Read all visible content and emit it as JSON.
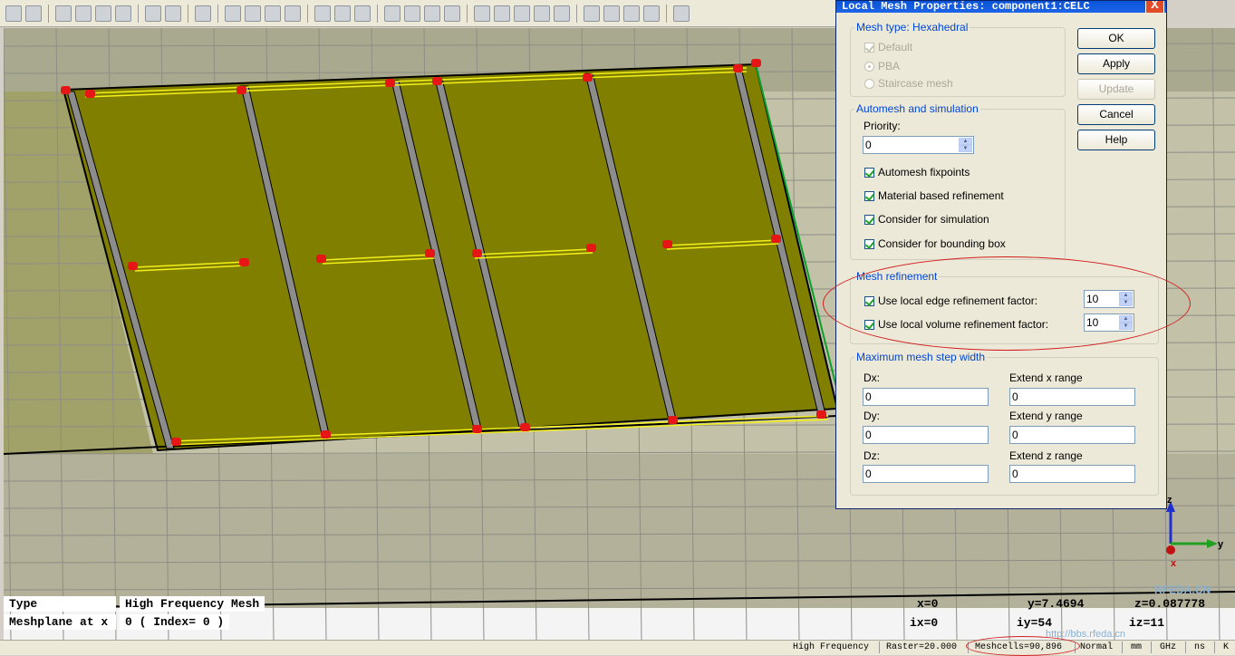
{
  "colors": {
    "board": "#807f00",
    "strip": "#8c8c8c",
    "port": "#e61616",
    "trace": "#f3f01a",
    "background": "#c3c1a8"
  },
  "dialog": {
    "title": "Local Mesh Properties: component1:CELC",
    "close_label": "X",
    "mesh_type": {
      "legend": "Mesh type: Hexahedral",
      "default_label": "Default",
      "pba_label": "PBA",
      "staircase_label": "Staircase mesh"
    },
    "automesh": {
      "legend": "Automesh and simulation",
      "priority_label": "Priority:",
      "priority_value": "0",
      "fixpoints_label": "Automesh fixpoints",
      "material_label": "Material based refinement",
      "simulation_label": "Consider for simulation",
      "bbox_label": "Consider for bounding box"
    },
    "refinement": {
      "legend": "Mesh refinement",
      "edge_label": "Use local edge refinement factor:",
      "edge_value": "10",
      "volume_label": "Use local volume refinement factor:",
      "volume_value": "10"
    },
    "step": {
      "legend": "Maximum mesh step width",
      "dx_label": "Dx:",
      "dx_value": "0",
      "dy_label": "Dy:",
      "dy_value": "0",
      "dz_label": "Dz:",
      "dz_value": "0",
      "ex_label": "Extend x range",
      "ex_value": "0",
      "ey_label": "Extend y range",
      "ey_value": "0",
      "ez_label": "Extend z range",
      "ez_value": "0"
    },
    "buttons": {
      "ok": "OK",
      "apply": "Apply",
      "update": "Update",
      "cancel": "Cancel",
      "help": "Help"
    }
  },
  "info": {
    "type_label": "Type",
    "type_value": "High Frequency Mesh",
    "meshplane_label": "Meshplane at x",
    "meshplane_value": "0 ( Index= 0 )",
    "x": "x=0",
    "y": "y=7.4694",
    "z": "z=0.087778",
    "ix": "ix=0",
    "iy": "iy=54",
    "iz": "iz=11"
  },
  "axes": {
    "z": "z",
    "y": "y",
    "x": "x"
  },
  "status": {
    "solver": "High Frequency",
    "raster": "Raster=20.000",
    "meshcells": "Meshcells=90,896",
    "mode": "Normal",
    "length_unit": "mm",
    "freq_unit": "GHz",
    "time_unit": "ns",
    "temp_unit": "K"
  },
  "watermark": {
    "site": "RFEDA.CN",
    "url": "http://bbs.rfeda.cn"
  }
}
